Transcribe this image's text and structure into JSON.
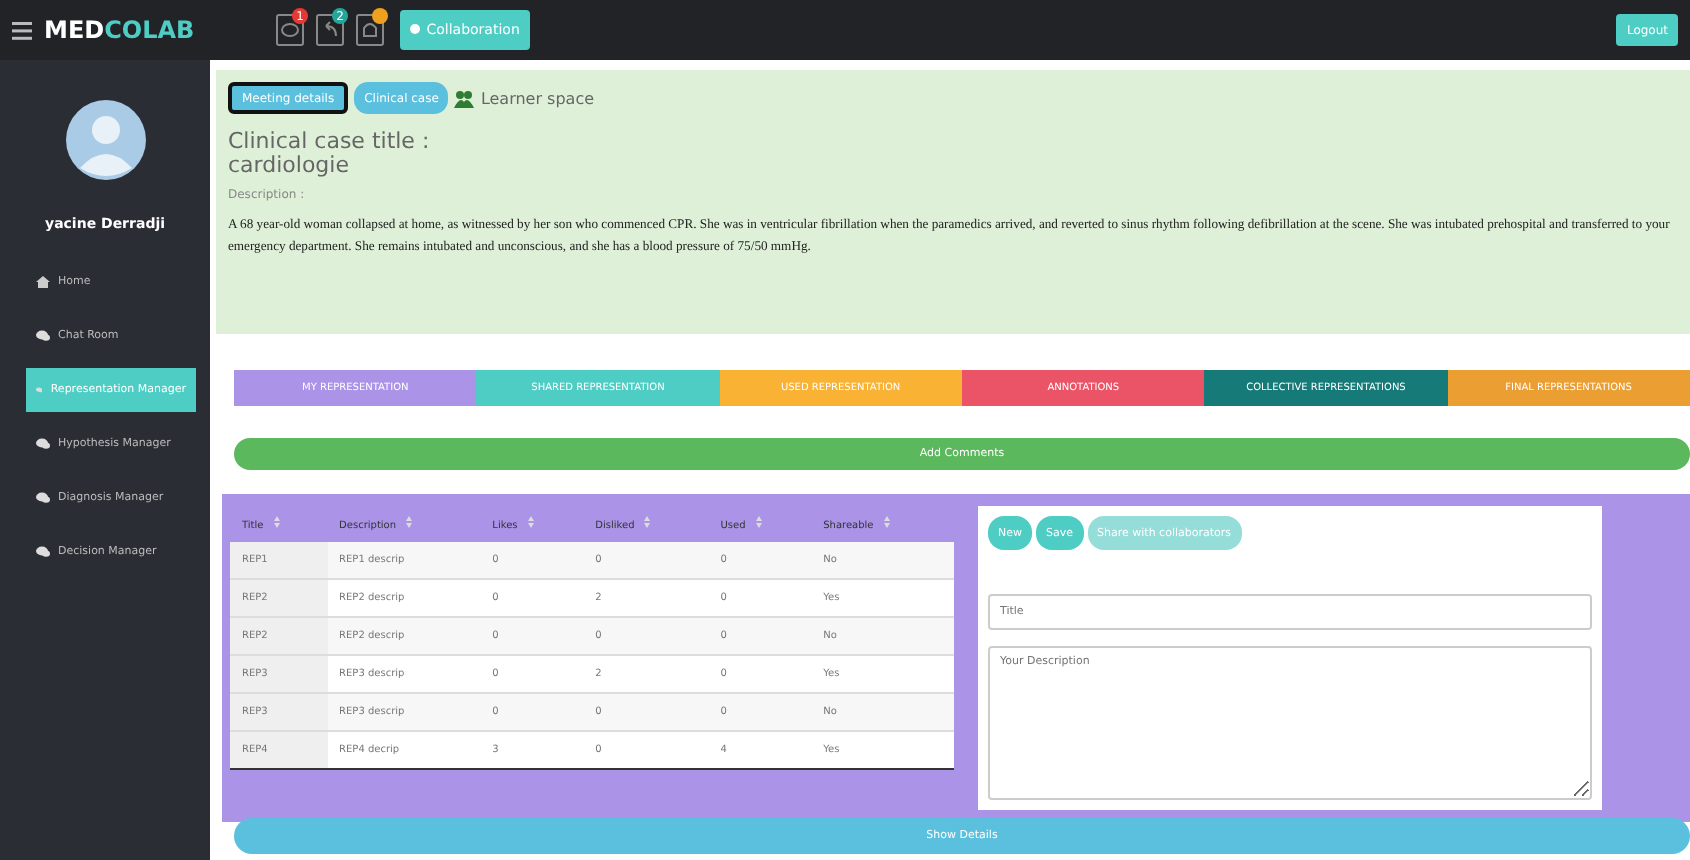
{
  "topbar": {
    "brand_bold": "MED",
    "brand_rest": "COLAB",
    "icons": [
      {
        "kind": "chat",
        "badge": "1",
        "color": "#e53935"
      },
      {
        "kind": "reply",
        "badge": "2",
        "color": "#26a69a"
      },
      {
        "kind": "bell",
        "color": "#f0a020"
      }
    ],
    "collaboration_button": "Collaboration",
    "logout_button": "Logout"
  },
  "sidebar": {
    "user_name": "yacine Derradji",
    "items": [
      {
        "label": "Home",
        "kind": "home",
        "selected": false
      },
      {
        "label": "Chat Room",
        "kind": "chat",
        "selected": false
      },
      {
        "label": "Representation Manager",
        "kind": "chat",
        "selected": true
      },
      {
        "label": "Hypothesis Manager",
        "kind": "chat",
        "selected": false
      },
      {
        "label": "Diagnosis Manager",
        "kind": "chat",
        "selected": false
      },
      {
        "label": "Decision Manager",
        "kind": "chat",
        "selected": false
      }
    ]
  },
  "case_panel": {
    "buttons": [
      {
        "label": "Meeting details",
        "selected": true
      },
      {
        "label": "Clinical case",
        "selected": false
      }
    ],
    "learner_space": "Learner space",
    "title_label": "Clinical case title :",
    "title_value": "cardiologie",
    "description_label": "Description :",
    "description": "A 68 year-old woman collapsed at home, as witnessed by her son who commenced CPR. She was in ventricular fibrillation when the paramedics arrived, and reverted to sinus rhythm following defibrillation at the scene. She was intubated prehospital and transferred to your emergency department. She remains intubated and unconscious, and she has a blood pressure of 75/50 mmHg."
  },
  "tabs": [
    {
      "label": "MY REPRESENTATION",
      "color": "#ab93e8"
    },
    {
      "label": "SHARED REPRESENTATION",
      "color": "#4ecdc4"
    },
    {
      "label": "USED REPRESENTATION",
      "color": "#f9b233"
    },
    {
      "label": "ANNOTATIONS",
      "color": "#ea5466"
    },
    {
      "label": "COLLECTIVE REPRESENTATIONS",
      "color": "#167a78"
    },
    {
      "label": "FINAL REPRESENTATIONS",
      "color": "#eb9e32"
    }
  ],
  "add_comments_button": "Add Comments",
  "table": {
    "columns": [
      "Title",
      "Description",
      "Likes",
      "Disliked",
      "Used",
      "Shareable"
    ],
    "rows": [
      [
        "REP1",
        "REP1 descrip",
        "0",
        "0",
        "0",
        "No"
      ],
      [
        "REP2",
        "REP2 descrip",
        "0",
        "2",
        "0",
        "Yes"
      ],
      [
        "REP2",
        "REP2 descrip",
        "0",
        "0",
        "0",
        "No"
      ],
      [
        "REP3",
        "REP3 descrip",
        "0",
        "2",
        "0",
        "Yes"
      ],
      [
        "REP3",
        "REP3 descrip",
        "0",
        "0",
        "0",
        "No"
      ],
      [
        "REP4",
        "REP4 decrip",
        "3",
        "0",
        "4",
        "Yes"
      ]
    ]
  },
  "form": {
    "buttons": [
      {
        "label": "New",
        "disabled": false
      },
      {
        "label": "Save",
        "disabled": false
      },
      {
        "label": "Share with collaborators",
        "disabled": true
      }
    ],
    "title_placeholder": "Title",
    "description_placeholder": "Your Description"
  },
  "show_details_button": "Show Details"
}
